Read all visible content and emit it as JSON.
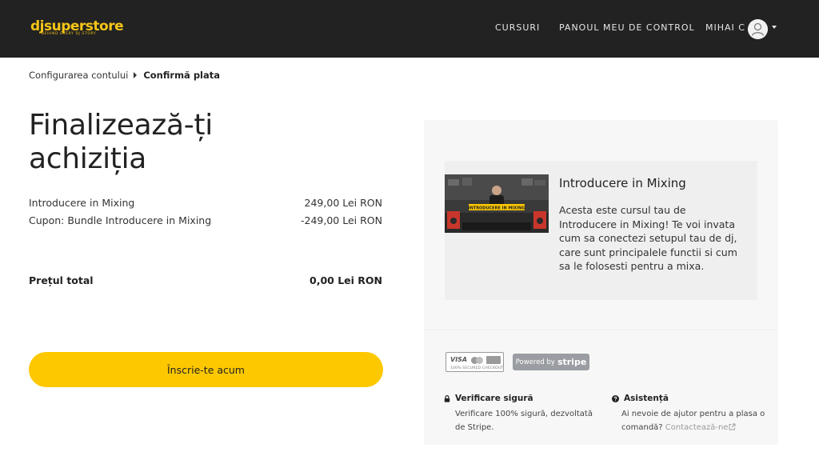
{
  "header": {
    "logo_text": "djsuperstore",
    "logo_tagline": "BEHIND EVERY DJ STORY",
    "nav": {
      "cursuri": "CURSURI",
      "panou": "PANOUL MEU DE CONTROL",
      "user": "MIHAI C"
    }
  },
  "breadcrumb": {
    "step1": "Configurarea contului",
    "step2": "Confirmă plata"
  },
  "checkout": {
    "title": "Finalizează-ți achiziția",
    "items": [
      {
        "label": "Introducere in Mixing",
        "price": "249,00 Lei RON"
      },
      {
        "label": "Cupon: Bundle Introducere in Mixing",
        "price": "-249,00 Lei RON"
      }
    ],
    "total_label": "Prețul total",
    "total_value": "0,00 Lei RON",
    "enroll_button": "Înscrie-te acum"
  },
  "course": {
    "title": "Introducere in Mixing",
    "thumbnail_caption": "INTRODUCERE IN MIXING",
    "description": "Acesta este cursul tau de Introducere in Mixing! Te voi invata cum sa conectezi setupul tau de dj, care sunt principalele functii si cum sa le folosesti pentru a mixa."
  },
  "badges": {
    "visa": "VISA",
    "secured": "100% SECURED CHECKOUT",
    "powered_by": "Powered by",
    "stripe": "stripe"
  },
  "info": {
    "secure_title": "Verificare sigură",
    "secure_text": "Verificare 100% sigură, dezvoltată de Stripe.",
    "assist_title": "Asistență",
    "assist_text": "Ai nevoie de ajutor pentru a plasa o comandă?",
    "contact_link": "Contactează-ne"
  },
  "colors": {
    "header_bg": "#222222",
    "brand_yellow": "#f5c518",
    "button_yellow": "#fdc800",
    "panel_bg": "#f7f7f7",
    "card_bg": "#efefef"
  }
}
